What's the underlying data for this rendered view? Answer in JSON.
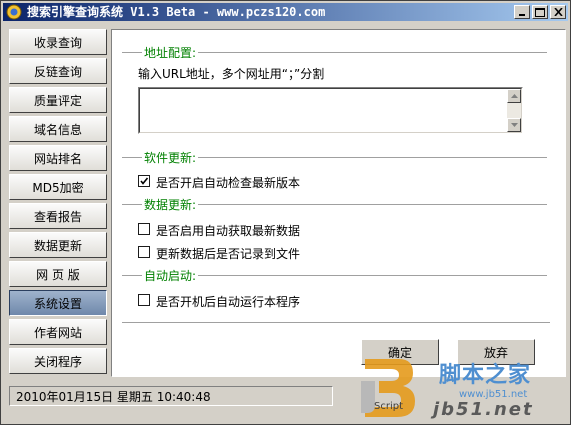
{
  "window": {
    "title": "搜索引擎查询系统 V1.3 Beta - www.pczs120.com"
  },
  "sidebar": {
    "items": [
      {
        "label": "收录查询"
      },
      {
        "label": "反链查询"
      },
      {
        "label": "质量评定"
      },
      {
        "label": "域名信息"
      },
      {
        "label": "网站排名"
      },
      {
        "label": "MD5加密"
      },
      {
        "label": "查看报告"
      },
      {
        "label": "数据更新"
      },
      {
        "label": "网 页 版"
      },
      {
        "label": "系统设置",
        "active": true
      },
      {
        "label": "作者网站"
      },
      {
        "label": "关闭程序"
      }
    ]
  },
  "settings": {
    "address": {
      "group_label": "地址配置:",
      "hint": "输入URL地址，多个网址用“；”分割",
      "value": ""
    },
    "software_update": {
      "group_label": "软件更新:",
      "auto_check_label": "是否开启自动检查最新版本",
      "auto_check_checked": true
    },
    "data_update": {
      "group_label": "数据更新:",
      "auto_fetch_label": "是否启用自动获取最新数据",
      "auto_fetch_checked": false,
      "record_label": "更新数据后是否记录到文件",
      "record_checked": false
    },
    "autostart": {
      "group_label": "自动启动:",
      "run_on_boot_label": "是否开机后自动运行本程序",
      "run_on_boot_checked": false
    },
    "ok_label": "确定",
    "cancel_label": "放弃"
  },
  "status": {
    "datetime": "2010年01月15日 星期五 10:40:48"
  },
  "watermark": {
    "brand_cn": "脚本之家",
    "script_text": "Script",
    "url_small": "www.jb51.net",
    "logo_big": "jb51.net"
  },
  "colors": {
    "titlebar_start": "#0a246a",
    "titlebar_end": "#a6caf0",
    "group_label": "#008000",
    "active_nav": "#7f96b8"
  }
}
